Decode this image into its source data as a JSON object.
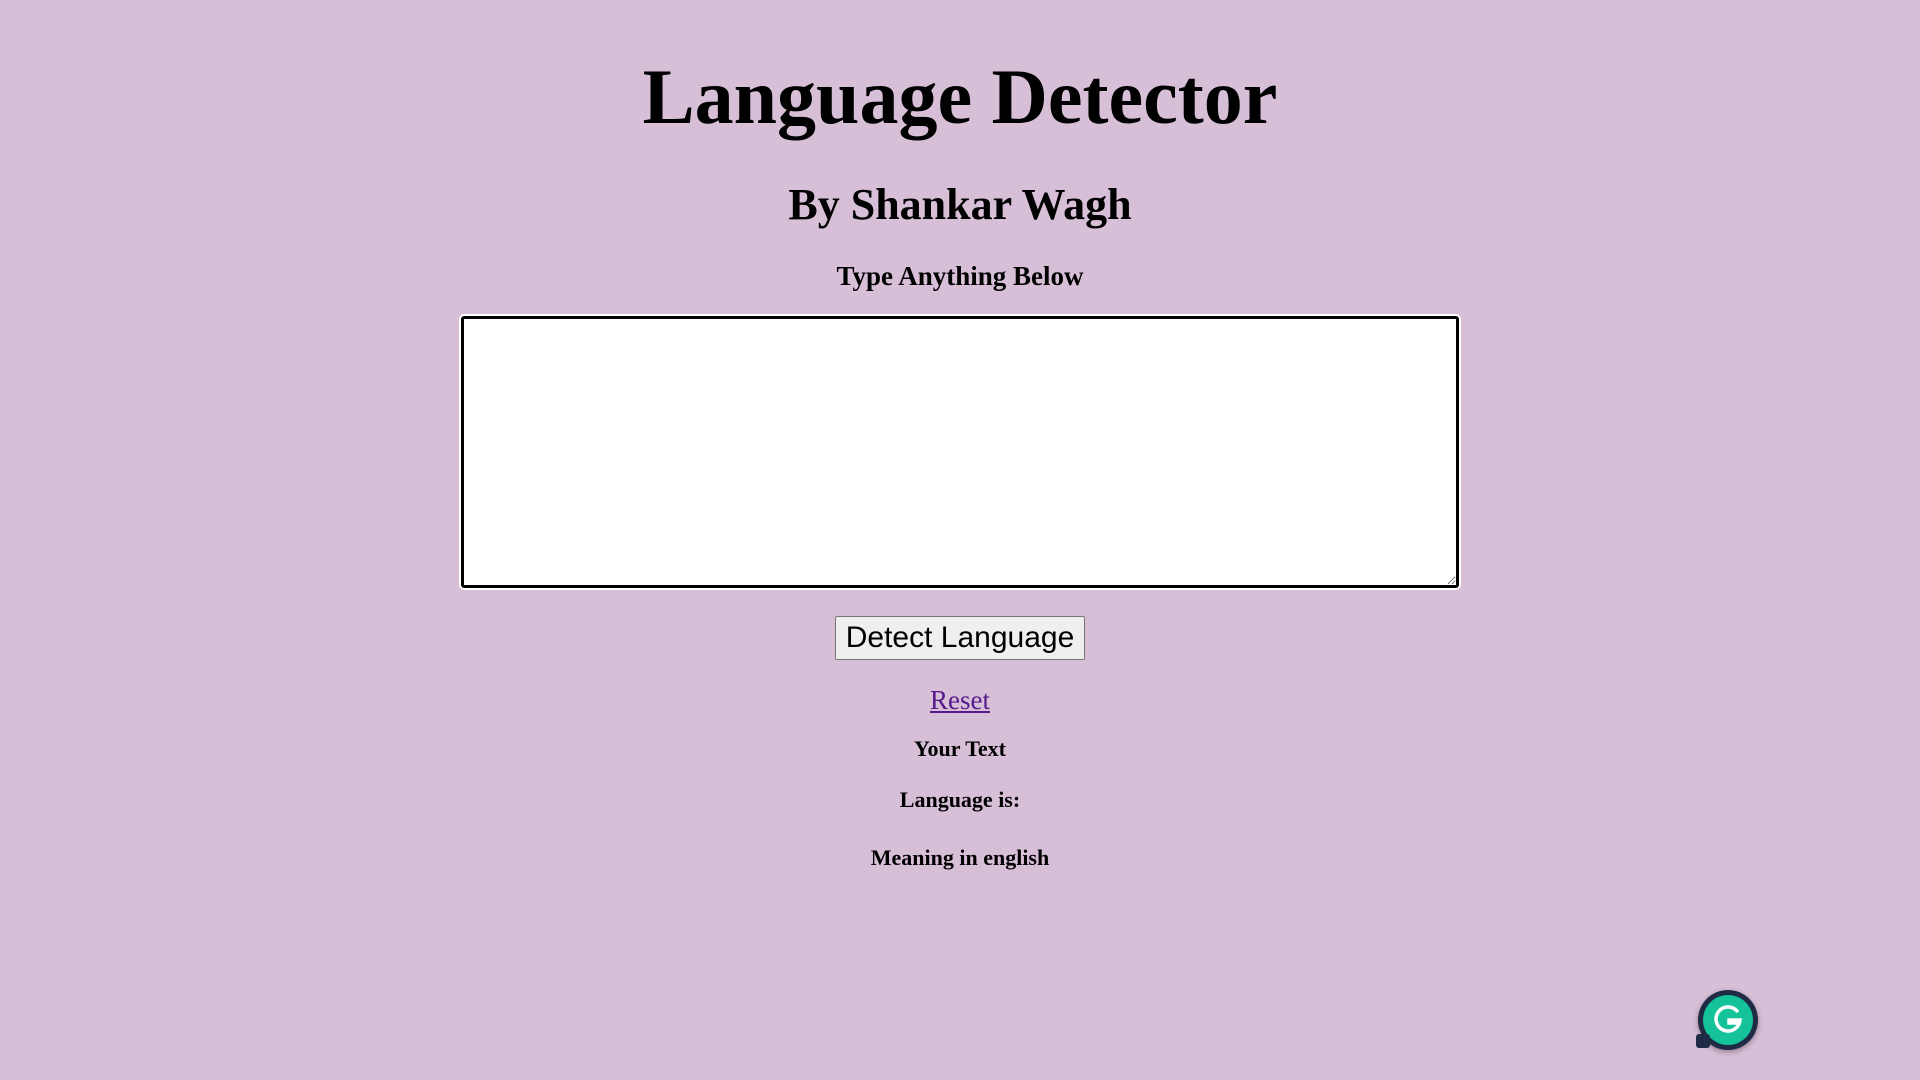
{
  "header": {
    "title": "Language Detector",
    "subtitle": "By Shankar Wagh"
  },
  "form": {
    "prompt": "Type Anything Below",
    "textarea_value": "",
    "detect_button_label": "Detect Language",
    "reset_link_label": "Reset"
  },
  "results": {
    "your_text_label": "Your Text",
    "language_label": "Language is:",
    "meaning_label": "Meaning in english"
  },
  "extension": {
    "icon": "grammarly-icon"
  },
  "colors": {
    "background": "#d8bfd8",
    "link": "#551a8b",
    "grammarly_green": "#15c39a"
  }
}
